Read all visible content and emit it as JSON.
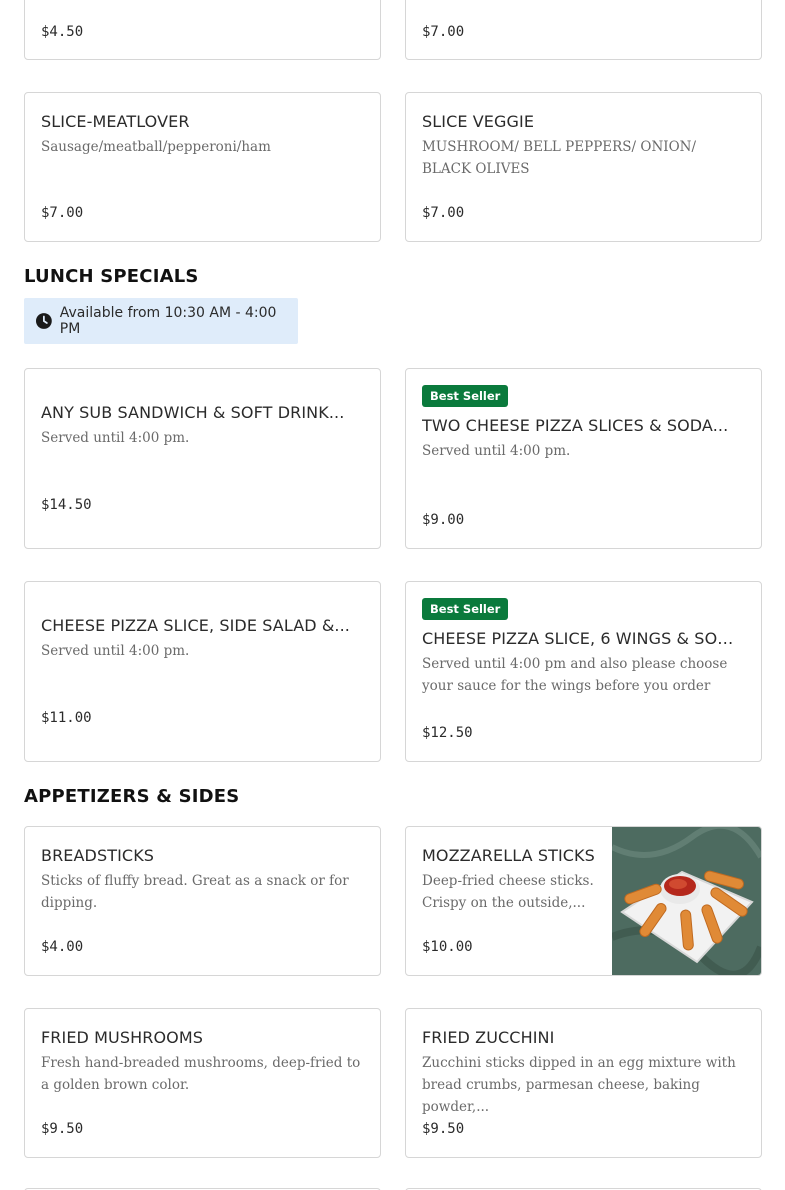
{
  "top_row": {
    "left_price": "$4.50",
    "right_price": "$7.00"
  },
  "slices": [
    {
      "name": "SLICE-MEATLOVER",
      "desc": "Sausage/meatball/pepperoni/ham",
      "price": "$7.00"
    },
    {
      "name": "SLICE VEGGIE",
      "desc": "MUSHROOM/ BELL PEPPERS/ ONION/ BLACK OLIVES",
      "price": "$7.00"
    }
  ],
  "lunch": {
    "title": "LUNCH SPECIALS",
    "availability": "Available from 10:30 AM - 4:00 PM",
    "items": [
      {
        "name": "ANY SUB SANDWICH & SOFT DRINK...",
        "desc": "Served until 4:00 pm.",
        "price": "$14.50",
        "badge": ""
      },
      {
        "name": "TWO CHEESE PIZZA SLICES & SODA...",
        "desc": "Served until 4:00 pm.",
        "price": "$9.00",
        "badge": "Best Seller"
      },
      {
        "name": "CHEESE PIZZA SLICE, SIDE SALAD &...",
        "desc": "Served until 4:00 pm.",
        "price": "$11.00",
        "badge": ""
      },
      {
        "name": "CHEESE PIZZA SLICE, 6 WINGS & SODA...",
        "desc": "Served until 4:00 pm and also please choose your sauce for the wings before you order",
        "price": "$12.50",
        "badge": "Best Seller"
      }
    ]
  },
  "apps": {
    "title": "APPETIZERS & SIDES",
    "items": [
      {
        "name": "BREADSTICKS",
        "desc": "Sticks of fluffy bread. Great as a snack or for dipping.",
        "price": "$4.00"
      },
      {
        "name": "MOZZARELLA STICKS",
        "desc": "Deep-fried cheese sticks. Crispy on the outside,...",
        "price": "$10.00"
      },
      {
        "name": "FRIED MUSHROOMS",
        "desc": "Fresh hand-breaded mushrooms, deep-fried to a golden brown color.",
        "price": "$9.50"
      },
      {
        "name": "FRIED ZUCCHINI",
        "desc": "Zucchini sticks dipped in an egg mixture with bread crumbs, parmesan cheese, baking powder,...",
        "price": "$9.50"
      }
    ]
  },
  "colors": {
    "badge": "#0a7a3c",
    "availability_bg": "#dfecfa",
    "border": "#d6d6d6"
  }
}
